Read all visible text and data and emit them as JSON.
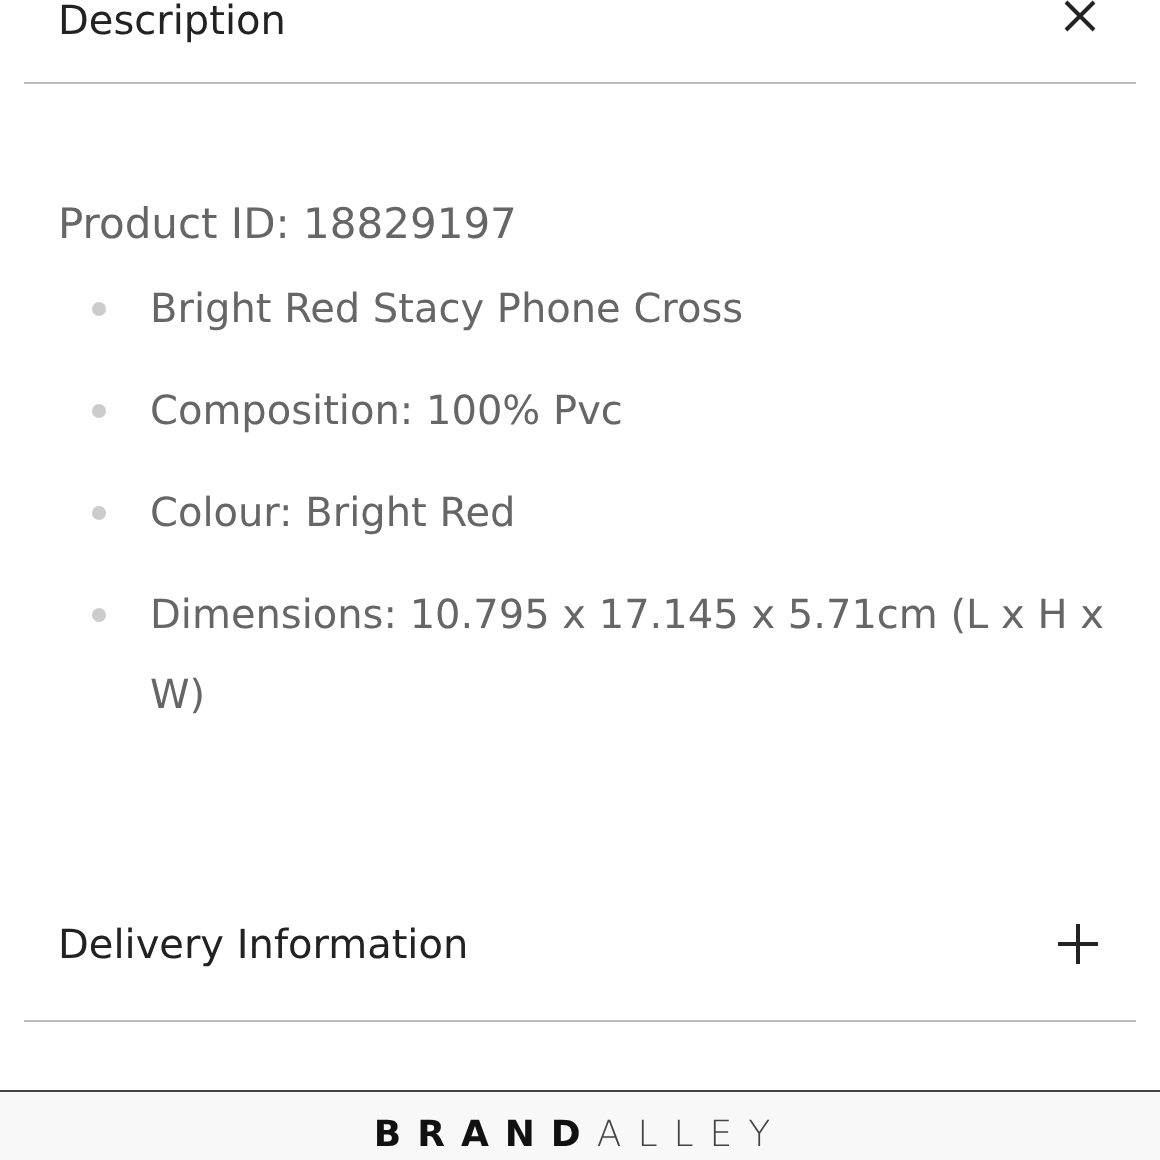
{
  "sections": [
    {
      "title": "Description",
      "expanded": true,
      "intro": "Product ID: 18829197",
      "bullets": [
        "Bright Red Stacy Phone Cross",
        "Composition: 100% Pvc",
        "Colour: Bright Red",
        "Dimensions: 10.795 x 17.145 x 5.71cm (L x H x W)"
      ]
    },
    {
      "title": "Delivery Information",
      "expanded": false
    }
  ],
  "footer": {
    "logo_bold": "BRAND",
    "logo_light": "ALLEY"
  }
}
